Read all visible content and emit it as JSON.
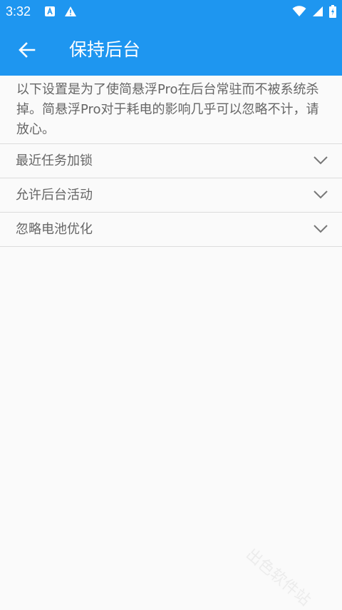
{
  "status_bar": {
    "time": "3:32",
    "left_icons": [
      "a-notification-icon",
      "warning-icon"
    ],
    "right_icons": [
      "wifi-icon",
      "signal-icon",
      "battery-icon"
    ]
  },
  "app_bar": {
    "back_icon": "arrow-left-icon",
    "title": "保持后台",
    "background_color": "#1e96f0"
  },
  "description": "以下设置是为了使简悬浮Pro在后台常驻而不被系统杀掉。简悬浮Pro对于耗电的影响几乎可以忽略不计，请放心。",
  "settings": {
    "items": [
      {
        "label": "最近任务加锁",
        "icon": "chevron-down-icon"
      },
      {
        "label": "允许后台活动",
        "icon": "chevron-down-icon"
      },
      {
        "label": "忽略电池优化",
        "icon": "chevron-down-icon"
      }
    ]
  },
  "watermark": "出色软件站"
}
